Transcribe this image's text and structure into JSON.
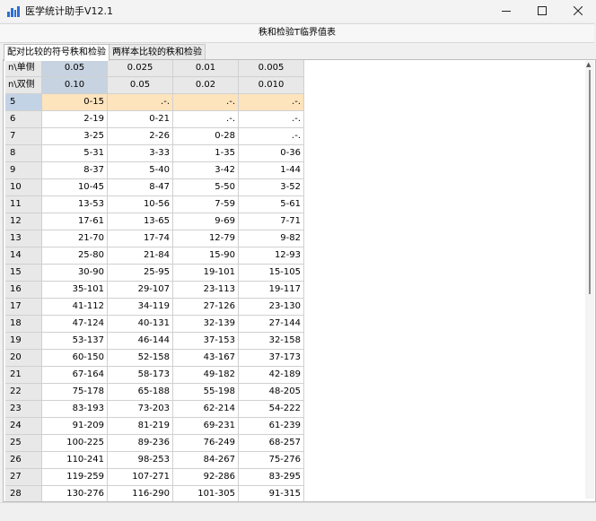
{
  "window": {
    "title": "医学统计助手V12.1",
    "minimize_icon": "minimize-icon",
    "maximize_icon": "maximize-icon",
    "close_icon": "close-icon"
  },
  "header": {
    "title": "秩和检验T临界值表"
  },
  "tabs": [
    {
      "label": "配对比较的符号秩和检验",
      "active": true
    },
    {
      "label": "两样本比较的秩和检验",
      "active": false
    }
  ],
  "table": {
    "header_rows": [
      [
        "n\\单侧",
        "0.05",
        "0.025",
        "0.01",
        "0.005"
      ],
      [
        "n\\双侧",
        "0.10",
        "0.05",
        "0.02",
        "0.010"
      ]
    ],
    "rows": [
      [
        "5",
        "0-15",
        ".-.",
        ".-.",
        ".-."
      ],
      [
        "6",
        "2-19",
        "0-21",
        ".-.",
        ".-."
      ],
      [
        "7",
        "3-25",
        "2-26",
        "0-28",
        ".-."
      ],
      [
        "8",
        "5-31",
        "3-33",
        "1-35",
        "0-36"
      ],
      [
        "9",
        "8-37",
        "5-40",
        "3-42",
        "1-44"
      ],
      [
        "10",
        "10-45",
        "8-47",
        "5-50",
        "3-52"
      ],
      [
        "11",
        "13-53",
        "10-56",
        "7-59",
        "5-61"
      ],
      [
        "12",
        "17-61",
        "13-65",
        "9-69",
        "7-71"
      ],
      [
        "13",
        "21-70",
        "17-74",
        "12-79",
        "9-82"
      ],
      [
        "14",
        "25-80",
        "21-84",
        "15-90",
        "12-93"
      ],
      [
        "15",
        "30-90",
        "25-95",
        "19-101",
        "15-105"
      ],
      [
        "16",
        "35-101",
        "29-107",
        "23-113",
        "19-117"
      ],
      [
        "17",
        "41-112",
        "34-119",
        "27-126",
        "23-130"
      ],
      [
        "18",
        "47-124",
        "40-131",
        "32-139",
        "27-144"
      ],
      [
        "19",
        "53-137",
        "46-144",
        "37-153",
        "32-158"
      ],
      [
        "20",
        "60-150",
        "52-158",
        "43-167",
        "37-173"
      ],
      [
        "21",
        "67-164",
        "58-173",
        "49-182",
        "42-189"
      ],
      [
        "22",
        "75-178",
        "65-188",
        "55-198",
        "48-205"
      ],
      [
        "23",
        "83-193",
        "73-203",
        "62-214",
        "54-222"
      ],
      [
        "24",
        "91-209",
        "81-219",
        "69-231",
        "61-239"
      ],
      [
        "25",
        "100-225",
        "89-236",
        "76-249",
        "68-257"
      ],
      [
        "26",
        "110-241",
        "98-253",
        "84-267",
        "75-276"
      ],
      [
        "27",
        "119-259",
        "107-271",
        "92-286",
        "83-295"
      ],
      [
        "28",
        "130-276",
        "116-290",
        "101-305",
        "91-315"
      ]
    ],
    "selected_row": 0
  },
  "colors": {
    "selected_row_fill": "#fde4bd",
    "selected_header_fill": "#c7d3e0",
    "app_icon": "#2a6fd6"
  }
}
